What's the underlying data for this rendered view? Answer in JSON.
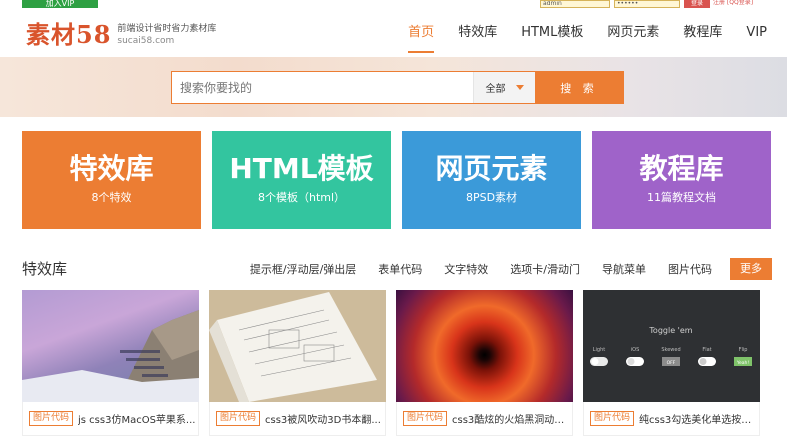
{
  "topbar": {
    "vip_label": "加入VIP",
    "username_value": "admin",
    "password_value": "••••••",
    "login_label": "登录",
    "links_text": "注册 [QQ登录]"
  },
  "header": {
    "logo_mark": "素材58",
    "slogan": "前端设计省时省力素材库",
    "domain": "sucai58.com"
  },
  "nav": {
    "items": [
      "首页",
      "特效库",
      "HTML模板",
      "网页元素",
      "教程库",
      "VIP"
    ]
  },
  "search": {
    "placeholder": "搜索你要找的",
    "category_selected": "全部",
    "button_label": "搜 索"
  },
  "tiles": [
    {
      "title": "特效库",
      "sub": "8个特效",
      "color": "#ec7d33"
    },
    {
      "title": "HTML模板",
      "sub": "8个模板（html）",
      "color": "#33c59f"
    },
    {
      "title": "网页元素",
      "sub": "8PSD素材",
      "color": "#3b9ad9"
    },
    {
      "title": "教程库",
      "sub": "11篇教程文档",
      "color": "#9f63c9"
    }
  ],
  "section": {
    "title": "特效库",
    "tabs": [
      "提示框/浮动层/弹出层",
      "表单代码",
      "文字特效",
      "选项卡/滑动门",
      "导航菜单",
      "图片代码"
    ],
    "more_label": "更多"
  },
  "cards": [
    {
      "tag": "图片代码",
      "title": "js css3仿MacOS苹果系..."
    },
    {
      "tag": "图片代码",
      "title": "css3被风吹动3D书本翻..."
    },
    {
      "tag": "图片代码",
      "title": "css3酷炫的火焰黑洞动画..."
    },
    {
      "tag": "图片代码",
      "title": "纯css3勾选美化单选按钮..."
    }
  ],
  "toggle_card": {
    "heading": "Toggle 'em",
    "labels": [
      "Light",
      "iOS",
      "Skewed",
      "Flat",
      "Flip"
    ],
    "skewed_state": "OFF",
    "flip_state": "Yeah!"
  }
}
